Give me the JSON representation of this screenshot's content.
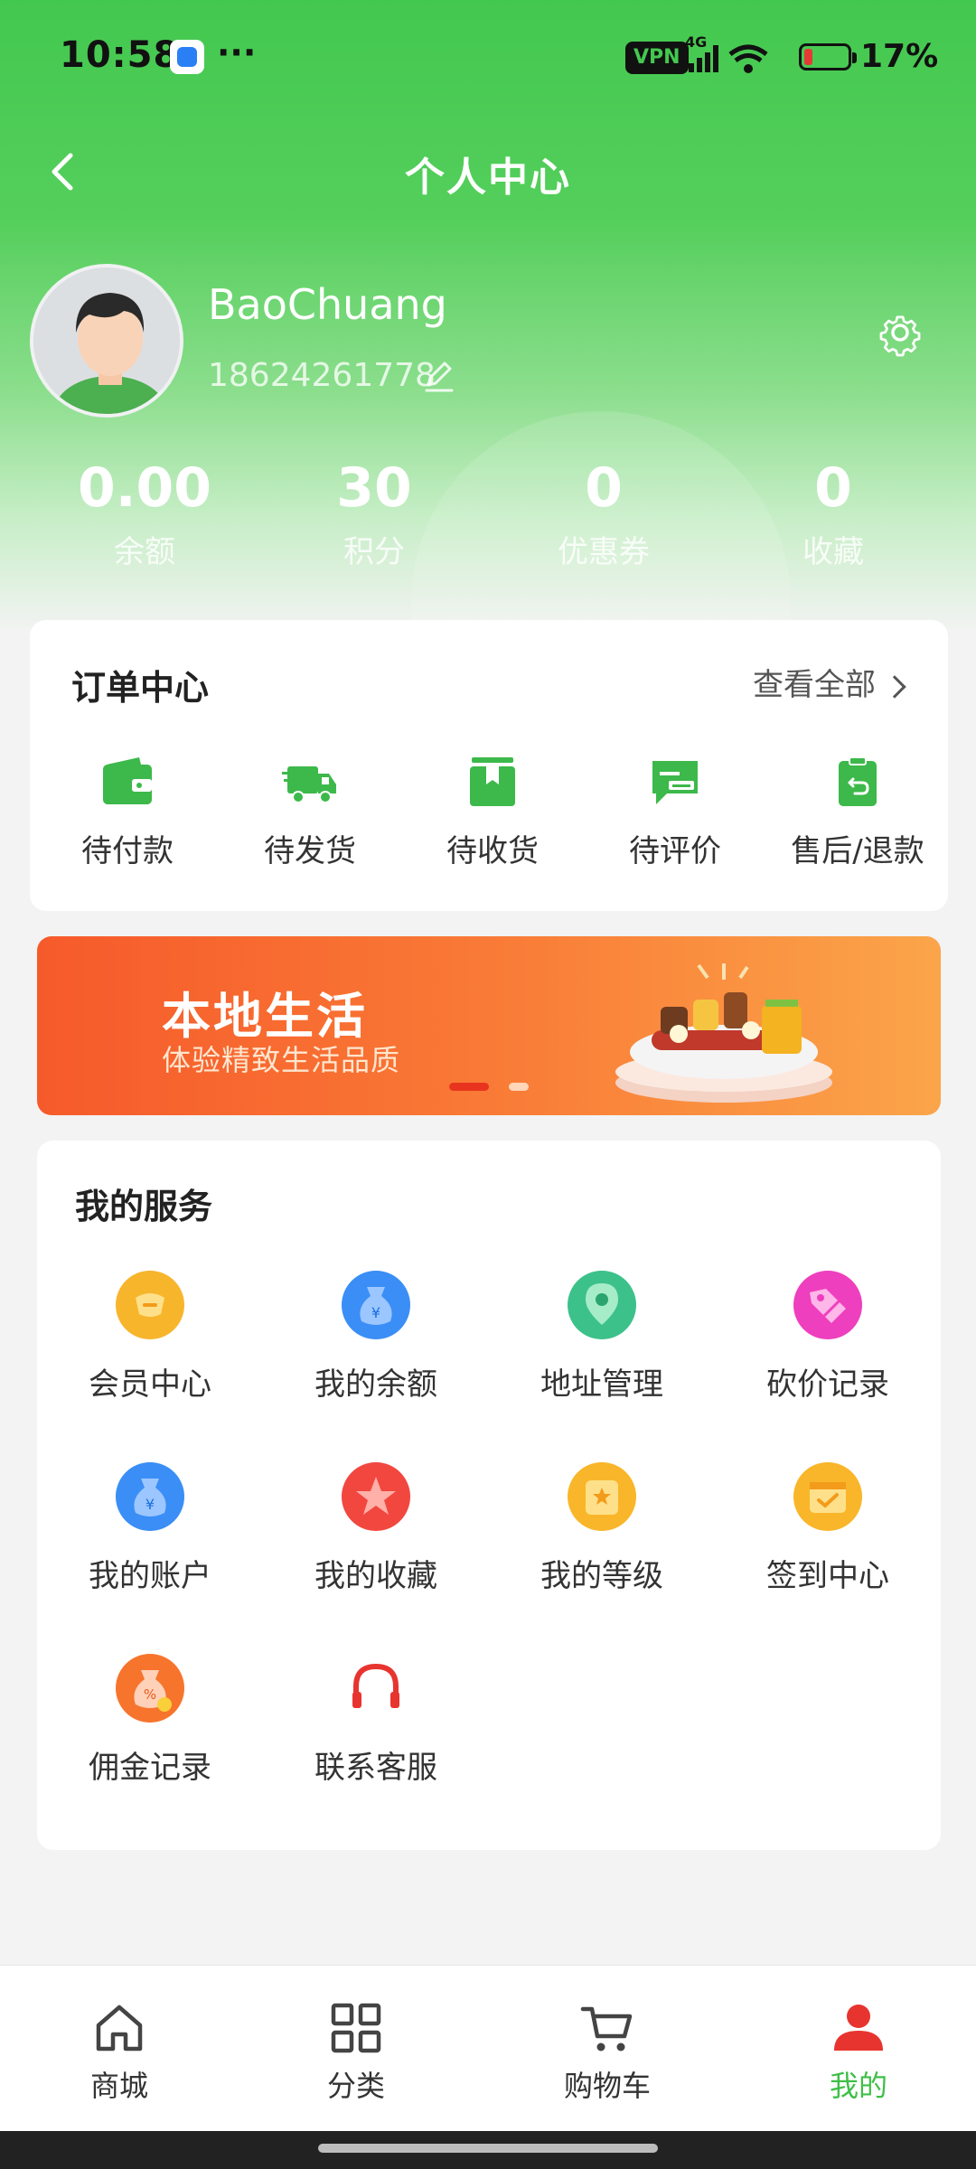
{
  "status_bar": {
    "time": "10:58",
    "dots": "···",
    "vpn": "VPN",
    "network": "4G",
    "battery": "17%"
  },
  "header": {
    "title": "个人中心"
  },
  "profile": {
    "name": "BaoChuang",
    "phone": "18624261778"
  },
  "stats": [
    {
      "value": "0.00",
      "label": "余额"
    },
    {
      "value": "30",
      "label": "积分"
    },
    {
      "value": "0",
      "label": "优惠券"
    },
    {
      "value": "0",
      "label": "收藏"
    }
  ],
  "orders": {
    "title": "订单中心",
    "view_all": "查看全部",
    "items": [
      {
        "label": "待付款",
        "icon": "wallet-icon"
      },
      {
        "label": "待发货",
        "icon": "truck-icon"
      },
      {
        "label": "待收货",
        "icon": "box-icon"
      },
      {
        "label": "待评价",
        "icon": "comment-icon"
      },
      {
        "label": "售后/退款",
        "icon": "refund-icon"
      }
    ]
  },
  "banner": {
    "title": "本地生活",
    "subtitle": "体验精致生活品质"
  },
  "services": {
    "title": "我的服务",
    "items": [
      {
        "label": "会员中心",
        "icon": "member-icon",
        "color": "#f7b52c"
      },
      {
        "label": "我的余额",
        "icon": "money-bag-icon",
        "color": "#3a8ef6"
      },
      {
        "label": "地址管理",
        "icon": "location-icon",
        "color": "#3cc18a"
      },
      {
        "label": "砍价记录",
        "icon": "tag-icon",
        "color": "#ee3fbe"
      },
      {
        "label": "我的账户",
        "icon": "account-bag-icon",
        "color": "#3a8ef6"
      },
      {
        "label": "我的收藏",
        "icon": "star-icon",
        "color": "#f2473f"
      },
      {
        "label": "我的等级",
        "icon": "level-icon",
        "color": "#f9b62a"
      },
      {
        "label": "签到中心",
        "icon": "calendar-check-icon",
        "color": "#f9b62a"
      },
      {
        "label": "佣金记录",
        "icon": "commission-icon",
        "color": "#f7742d"
      },
      {
        "label": "联系客服",
        "icon": "headset-icon",
        "color": "#e8342f"
      }
    ]
  },
  "tabbar": [
    {
      "label": "商城",
      "icon": "home-icon"
    },
    {
      "label": "分类",
      "icon": "grid-icon"
    },
    {
      "label": "购物车",
      "icon": "cart-icon"
    },
    {
      "label": "我的",
      "icon": "user-icon",
      "active": true
    }
  ],
  "colors": {
    "primary": "#43c84f",
    "active_tab": "#3fbf48",
    "banner": "#f65a2b"
  }
}
